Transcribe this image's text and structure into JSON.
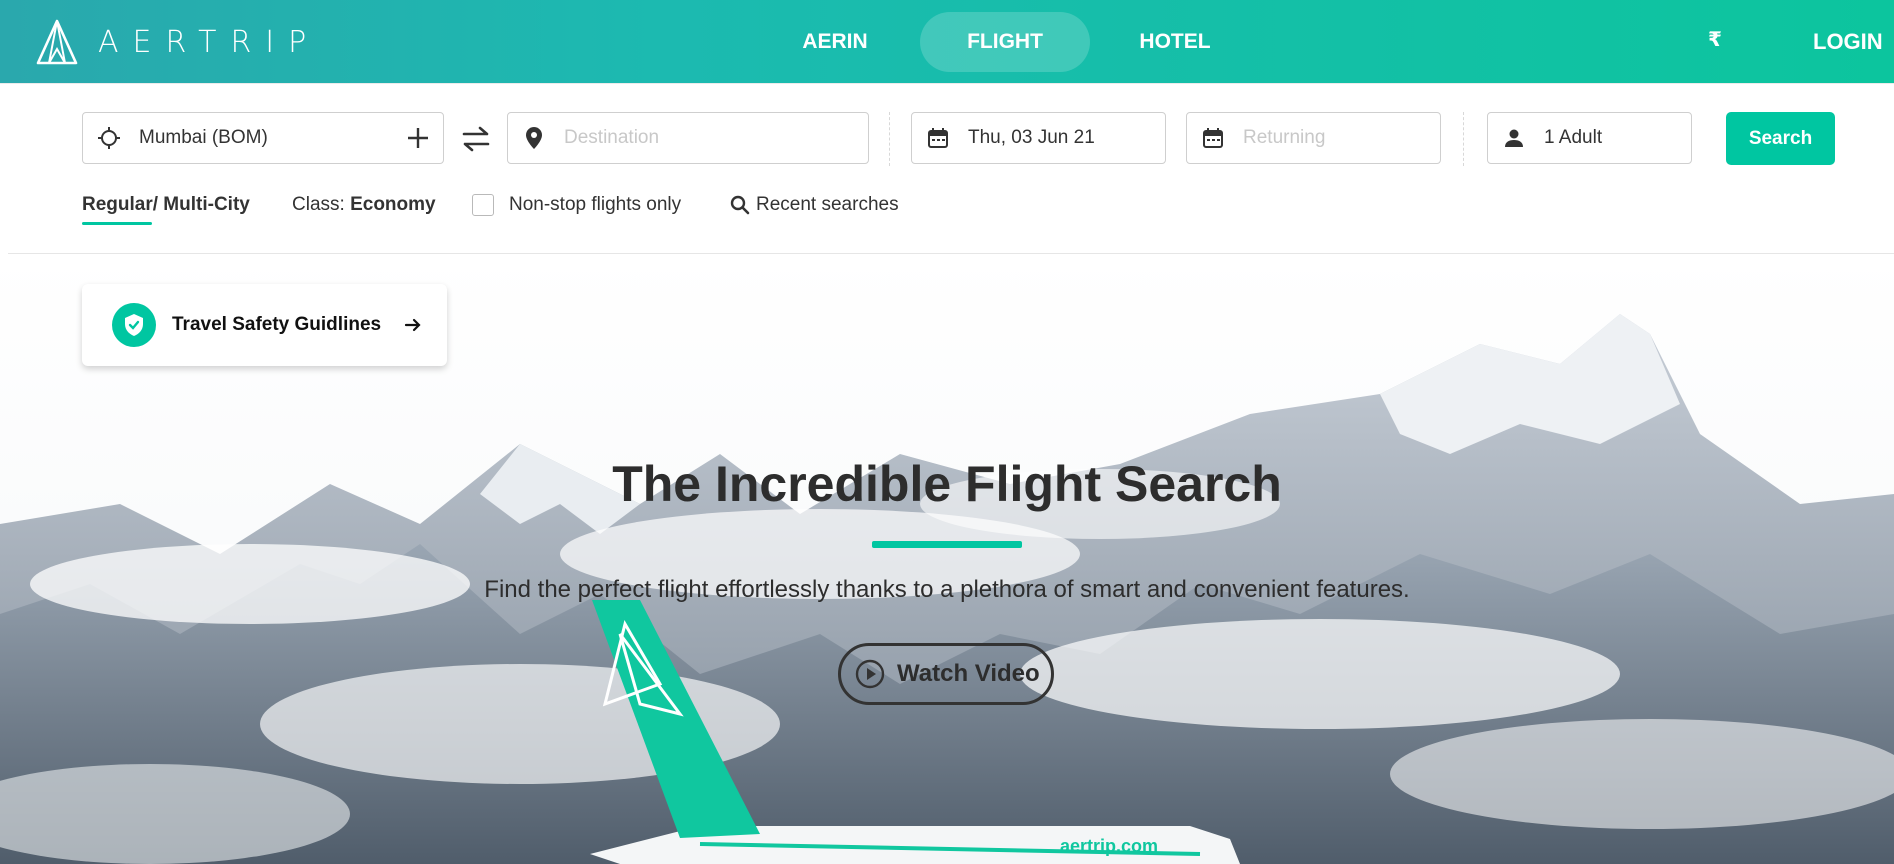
{
  "header": {
    "logo_text": "AERTRIP",
    "nav": [
      {
        "label": "AERIN",
        "active": false
      },
      {
        "label": "FLIGHT",
        "active": true
      },
      {
        "label": "HOTEL",
        "active": false
      }
    ],
    "currency_symbol": "₹",
    "login_label": "LOGIN"
  },
  "search": {
    "origin_value": "Mumbai (BOM)",
    "destination_placeholder": "Destination",
    "depart_value": "Thu, 03 Jun 21",
    "return_placeholder": "Returning",
    "travellers_value": "1 Adult",
    "search_label": "Search"
  },
  "options": {
    "trip_regular": "Regular",
    "trip_multi": "/ Multi-City",
    "class_label": "Class:",
    "class_value": "Economy",
    "nonstop_label": "Non-stop flights only",
    "nonstop_checked": false,
    "recent_label": "Recent searches"
  },
  "safety": {
    "label": "Travel Safety Guidlines"
  },
  "hero": {
    "title": "The Incredible Flight Search",
    "subtitle": "Find the perfect flight effortlessly thanks to a plethora of smart and convenient features.",
    "watch_label": "Watch Video",
    "plane_brand": "aertrip.com"
  },
  "colors": {
    "accent": "#00c6a1",
    "header_start": "#2aa8ad",
    "header_end": "#0cc59e",
    "text_dark": "#2d2d2d"
  },
  "icons": {
    "origin": "crosshair-icon",
    "add": "plus-icon",
    "swap": "swap-arrows-icon",
    "destination": "map-pin-icon",
    "date": "calendar-icon",
    "traveller": "person-icon",
    "recent": "search-icon",
    "safety": "shield-check-icon",
    "arrow": "arrow-right-icon",
    "play": "play-icon"
  }
}
